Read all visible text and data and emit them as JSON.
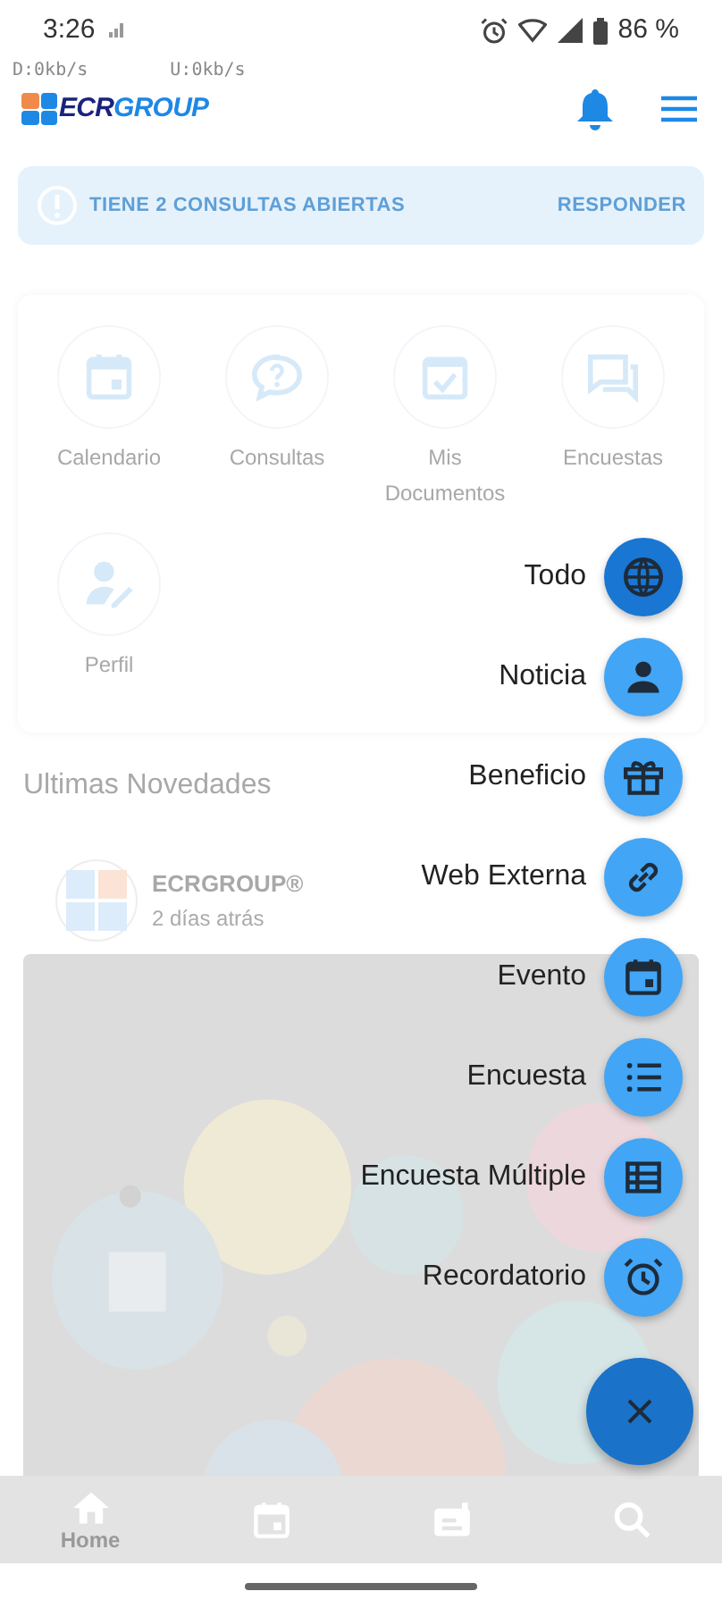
{
  "status_bar": {
    "time": "3:26",
    "battery": "86 %"
  },
  "net_speed": [
    "D:0kb/s",
    "U:0kb/s"
  ],
  "header": {
    "logo": {
      "part1": "ECR",
      "part2": "GROUP"
    }
  },
  "alert": {
    "message": "TIENE 2 CONSULTAS ABIERTAS",
    "action": "RESPONDER"
  },
  "shortcuts": [
    {
      "kind": "calendar",
      "label": "Calendario"
    },
    {
      "kind": "question",
      "label": "Consultas"
    },
    {
      "kind": "check",
      "label": "Mis Documentos"
    },
    {
      "kind": "chat",
      "label": "Encuestas"
    },
    {
      "kind": "profile",
      "label": "Perfil"
    }
  ],
  "section_title": "Ultimas Novedades",
  "post": {
    "author": "ECRGROUP®",
    "time": "2 días atrás"
  },
  "speed_dial": [
    {
      "kind": "globe",
      "label": "Todo",
      "selected": true
    },
    {
      "kind": "person",
      "label": "Noticia",
      "selected": false
    },
    {
      "kind": "gift",
      "label": "Beneficio",
      "selected": false
    },
    {
      "kind": "link",
      "label": "Web Externa",
      "selected": false
    },
    {
      "kind": "calendar",
      "label": "Evento",
      "selected": false
    },
    {
      "kind": "list",
      "label": "Encuesta",
      "selected": false
    },
    {
      "kind": "table",
      "label": "Encuesta Múltiple",
      "selected": false
    },
    {
      "kind": "alarm",
      "label": "Recordatorio",
      "selected": false
    }
  ],
  "bottom_nav": [
    {
      "kind": "home",
      "label": "Home"
    },
    {
      "kind": "calendar"
    },
    {
      "kind": "news"
    },
    {
      "kind": "search"
    }
  ]
}
